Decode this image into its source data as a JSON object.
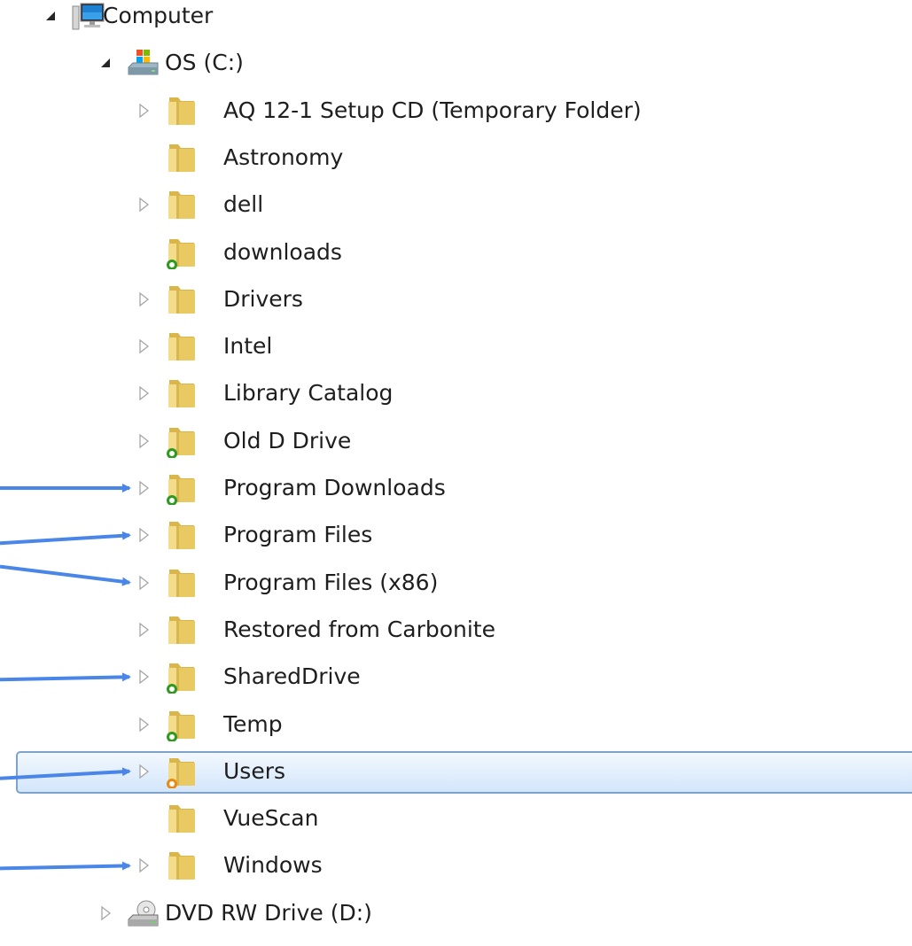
{
  "tree": {
    "items": [
      {
        "label": "Computer",
        "icon": "computer-icon",
        "expander": "expanded",
        "level": 0
      },
      {
        "label": "OS (C:)",
        "icon": "os-drive-icon",
        "expander": "expanded",
        "level": 1
      },
      {
        "label": "AQ 12-1 Setup CD (Temporary Folder)",
        "icon": "folder-icon",
        "expander": "collapsed",
        "level": 2
      },
      {
        "label": "Astronomy",
        "icon": "folder-icon",
        "expander": "none",
        "level": 2
      },
      {
        "label": "dell",
        "icon": "folder-icon",
        "expander": "collapsed",
        "level": 2
      },
      {
        "label": "downloads",
        "icon": "shared-folder-icon",
        "expander": "none",
        "level": 2
      },
      {
        "label": "Drivers",
        "icon": "folder-icon",
        "expander": "collapsed",
        "level": 2
      },
      {
        "label": "Intel",
        "icon": "folder-icon",
        "expander": "collapsed",
        "level": 2
      },
      {
        "label": "Library Catalog",
        "icon": "folder-icon",
        "expander": "collapsed",
        "level": 2
      },
      {
        "label": "Old D Drive",
        "icon": "shared-folder-icon",
        "expander": "collapsed",
        "level": 2
      },
      {
        "label": "Program Downloads",
        "icon": "shared-folder-icon",
        "expander": "collapsed",
        "level": 2
      },
      {
        "label": "Program Files",
        "icon": "folder-icon",
        "expander": "collapsed",
        "level": 2
      },
      {
        "label": "Program Files (x86)",
        "icon": "folder-icon",
        "expander": "collapsed",
        "level": 2
      },
      {
        "label": "Restored from Carbonite",
        "icon": "folder-icon",
        "expander": "collapsed",
        "level": 2
      },
      {
        "label": "SharedDrive",
        "icon": "shared-folder-icon",
        "expander": "collapsed",
        "level": 2
      },
      {
        "label": "Temp",
        "icon": "shared-folder-icon",
        "expander": "collapsed",
        "level": 2
      },
      {
        "label": "Users",
        "icon": "users-shared-folder-icon",
        "expander": "collapsed",
        "level": 2,
        "selected": true
      },
      {
        "label": "VueScan",
        "icon": "folder-icon",
        "expander": "none",
        "level": 2
      },
      {
        "label": "Windows",
        "icon": "folder-icon",
        "expander": "collapsed",
        "level": 2
      },
      {
        "label": "DVD RW Drive (D:)",
        "icon": "dvd-drive-icon",
        "expander": "collapsed",
        "level": 1
      }
    ]
  },
  "annotations": {
    "arrow_color": "#4a86e8",
    "pointed_items": [
      "Program Downloads",
      "Program Files",
      "Program Files (x86)",
      "SharedDrive",
      "Users",
      "Windows"
    ]
  },
  "colors": {
    "selection_border": "#7da2ce",
    "expander": "#a6a6a6",
    "folder": "#e8c962",
    "share_ring_green": "#2f9a1f",
    "share_ring_orange": "#e98a12"
  }
}
